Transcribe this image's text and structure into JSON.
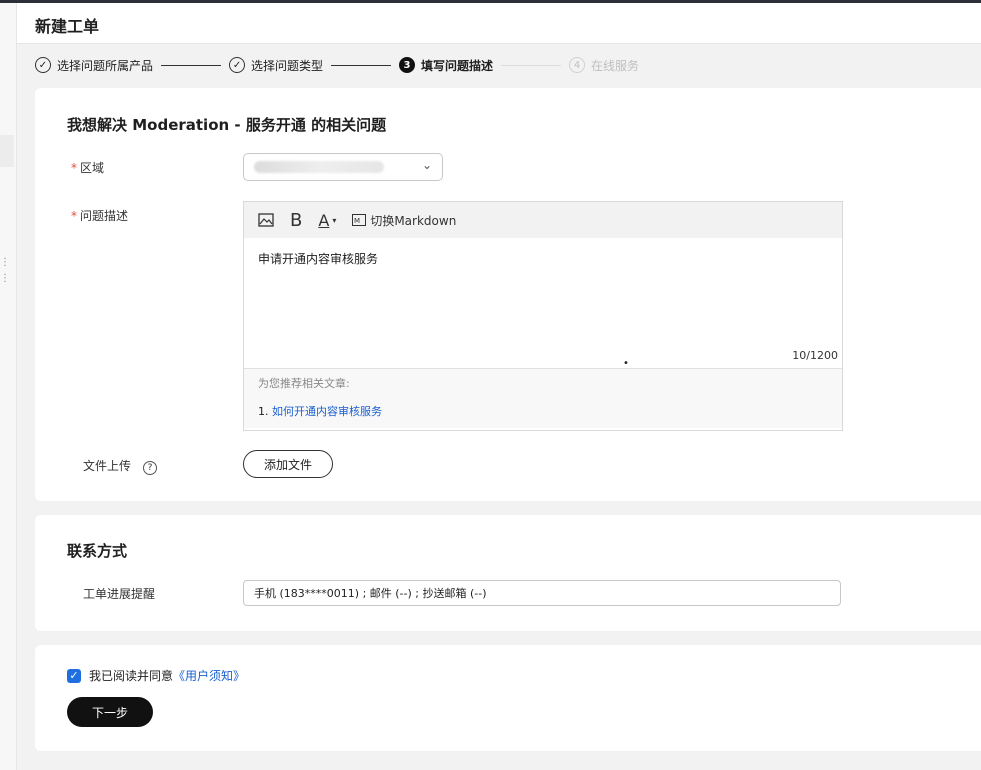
{
  "header": {
    "title": "新建工单"
  },
  "steps": [
    {
      "label": "选择问题所属产品",
      "state": "done"
    },
    {
      "label": "选择问题类型",
      "state": "done"
    },
    {
      "label": "填写问题描述",
      "state": "active",
      "num": "3"
    },
    {
      "label": "在线服务",
      "state": "pending",
      "num": "4"
    }
  ],
  "form": {
    "title": "我想解决 Moderation - 服务开通 的相关问题",
    "region_label": "区域",
    "desc_label": "问题描述",
    "toolbar": {
      "markdown": "切换Markdown"
    },
    "desc_text": "申请开通内容审核服务",
    "counter": "10/1200",
    "recommend_title": "为您推荐相关文章:",
    "recommend_index": "1.",
    "recommend_link": "如何开通内容审核服务",
    "upload_label": "文件上传",
    "upload_button": "添加文件"
  },
  "contact": {
    "title": "联系方式",
    "progress_label": "工单进展提醒",
    "progress_value": "手机 (183****0011) ; 邮件 (--) ; 抄送邮箱 (--)"
  },
  "agree": {
    "text": "我已阅读并同意",
    "link": "《用户须知》",
    "checked": true
  },
  "next_button": "下一步",
  "colors": {
    "accent": "#1f6fe0",
    "required": "#e74c3c",
    "primary_button": "#111111"
  }
}
